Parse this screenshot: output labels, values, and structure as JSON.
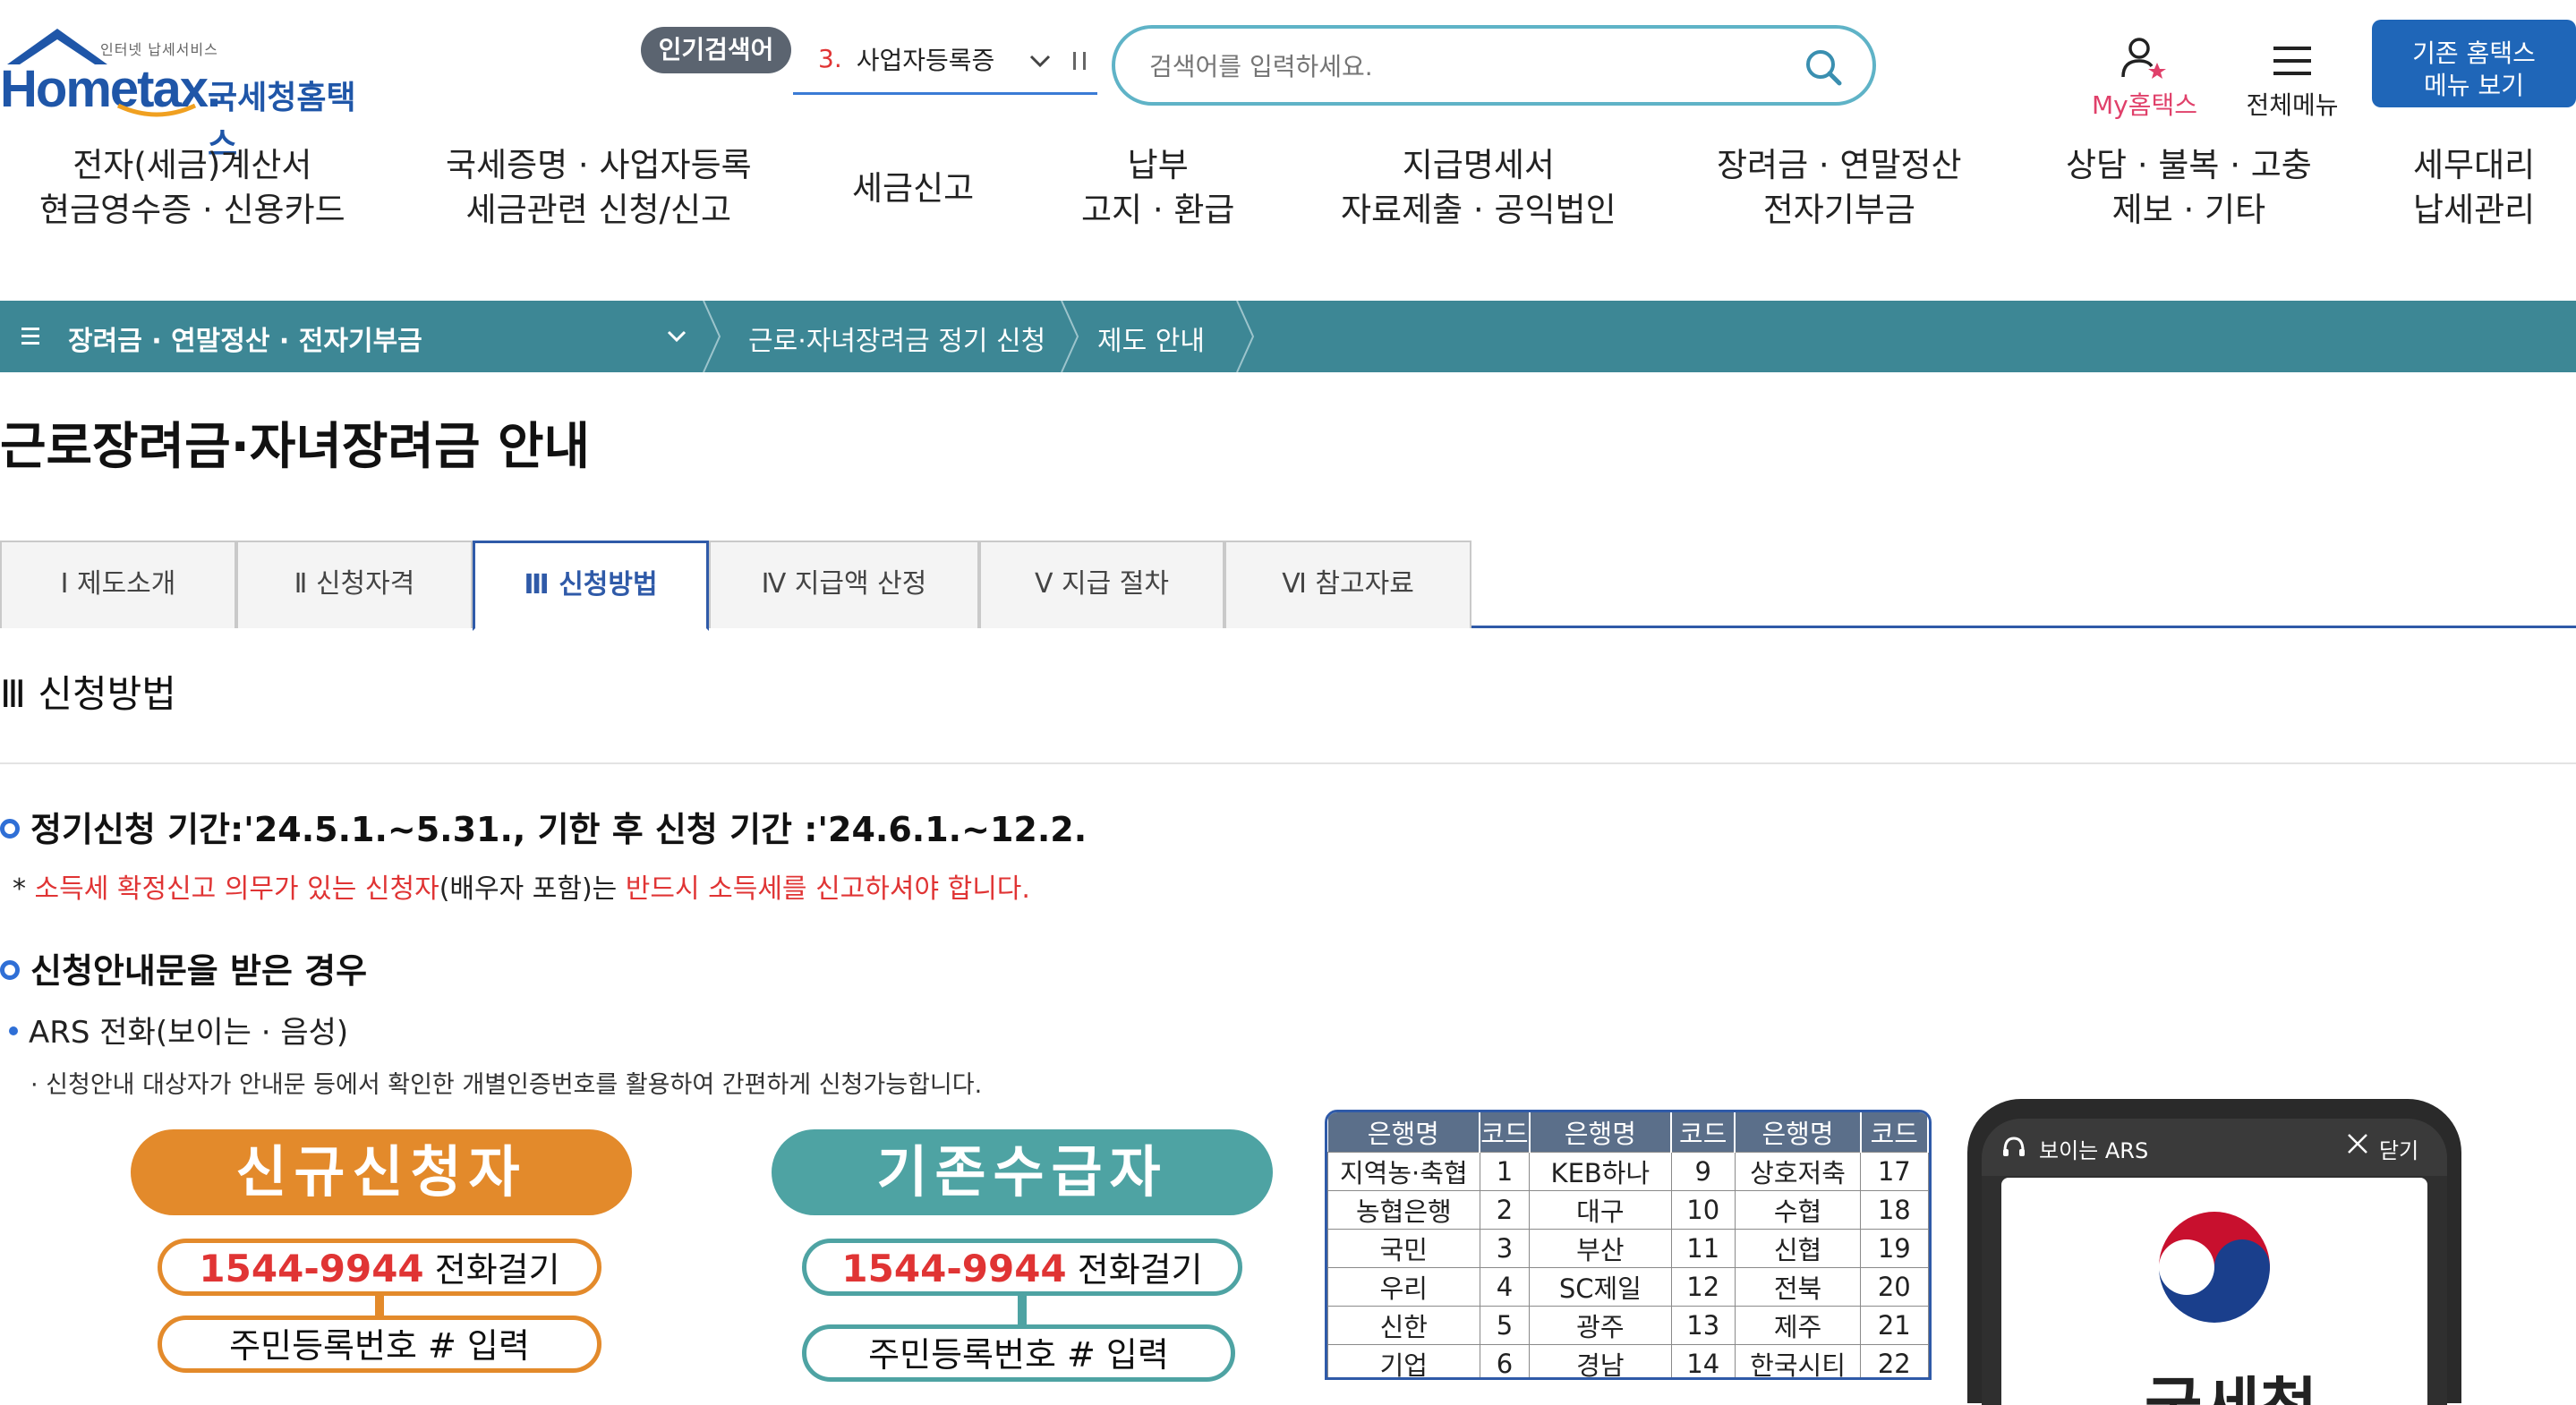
{
  "header": {
    "logo": {
      "sub": "인터넷 납세서비스",
      "brand": "Hometax.",
      "name_ko": "국세청홈택스"
    },
    "popular": {
      "badge": "인기검색어",
      "rank": "3.",
      "term": "사업자등록증"
    },
    "search": {
      "placeholder": "검색어를 입력하세요."
    },
    "my_hometax": "My홈택스",
    "all_menu": "전체메뉴",
    "old_hometax": {
      "line1": "기존 홈택스",
      "line2": "메뉴 보기"
    }
  },
  "main_nav": [
    {
      "line1": "전자(세금)계산서",
      "line2": "현금영수증 · 신용카드"
    },
    {
      "line1": "국세증명 · 사업자등록",
      "line2": "세금관련 신청/신고"
    },
    {
      "line1": "세금신고",
      "line2": ""
    },
    {
      "line1": "납부",
      "line2": "고지 · 환급"
    },
    {
      "line1": "지급명세서",
      "line2": "자료제출 · 공익법인"
    },
    {
      "line1": "장려금 · 연말정산",
      "line2": "전자기부금"
    },
    {
      "line1": "상담 · 불복 · 고충",
      "line2": "제보 · 기타"
    },
    {
      "line1": "세무대리",
      "line2": "납세관리"
    }
  ],
  "breadcrumb": {
    "section": "장려금 · 연말정산 · 전자기부금",
    "items": [
      "근로·자녀장려금 정기 신청",
      "제도 안내"
    ]
  },
  "page_title": "근로장려금·자녀장려금 안내",
  "tabs": [
    {
      "label": "Ⅰ  제도소개"
    },
    {
      "label": "Ⅱ  신청자격"
    },
    {
      "label": "Ⅲ  신청방법"
    },
    {
      "label": "Ⅳ  지급액 산정"
    },
    {
      "label": "Ⅴ  지급 절차"
    },
    {
      "label": "Ⅵ  참고자료"
    }
  ],
  "section_title": "Ⅲ  신청방법",
  "content": {
    "period": "정기신청 기간:'24.5.1.~5.31., 기한 후 신청 기간 :'24.6.1.~12.2.",
    "note_star": "* ",
    "note_red1": "소득세 확정신고 의무가 있는 신청자",
    "note_mid": "(배우자 포함)는 ",
    "note_red2": "반드시 소득세를 신고하셔야 합니다.",
    "heading2": "신청안내문을 받은 경우",
    "ars_heading": "ARS 전화(보이는 · 음성)",
    "ars_note": "· 신청안내 대상자가 안내문 등에서 확인한 개별인증번호를 활용하여 간편하게 신청가능합니다."
  },
  "flows": [
    {
      "title": "신규신청자",
      "phone": "1544-9944",
      "call": " 전화걸기",
      "step2": "주민등록번호 # 입력",
      "color": "#e38a2b"
    },
    {
      "title": "기존수급자",
      "phone": "1544-9944",
      "call": " 전화걸기",
      "step2": "주민등록번호 # 입력",
      "color": "#4ea3a3"
    }
  ],
  "bank_table": {
    "headers": [
      "은행명",
      "코드",
      "은행명",
      "코드",
      "은행명",
      "코드"
    ],
    "rows": [
      [
        "지역농·축협",
        "1",
        "KEB하나",
        "9",
        "상호저축",
        "17"
      ],
      [
        "농협은행",
        "2",
        "대구",
        "10",
        "수협",
        "18"
      ],
      [
        "국민",
        "3",
        "부산",
        "11",
        "신협",
        "19"
      ],
      [
        "우리",
        "4",
        "SC제일",
        "12",
        "전북",
        "20"
      ],
      [
        "신한",
        "5",
        "광주",
        "13",
        "제주",
        "21"
      ],
      [
        "기업",
        "6",
        "경남",
        "14",
        "한국시티",
        "22"
      ]
    ]
  },
  "phone": {
    "title": "보이는 ARS",
    "close": "닫기",
    "org": "국세청"
  },
  "colors": {
    "brand": "#1f56a8",
    "accent": "#3d8795",
    "tab_active": "#2f5aa8",
    "alert": "#e03434"
  }
}
